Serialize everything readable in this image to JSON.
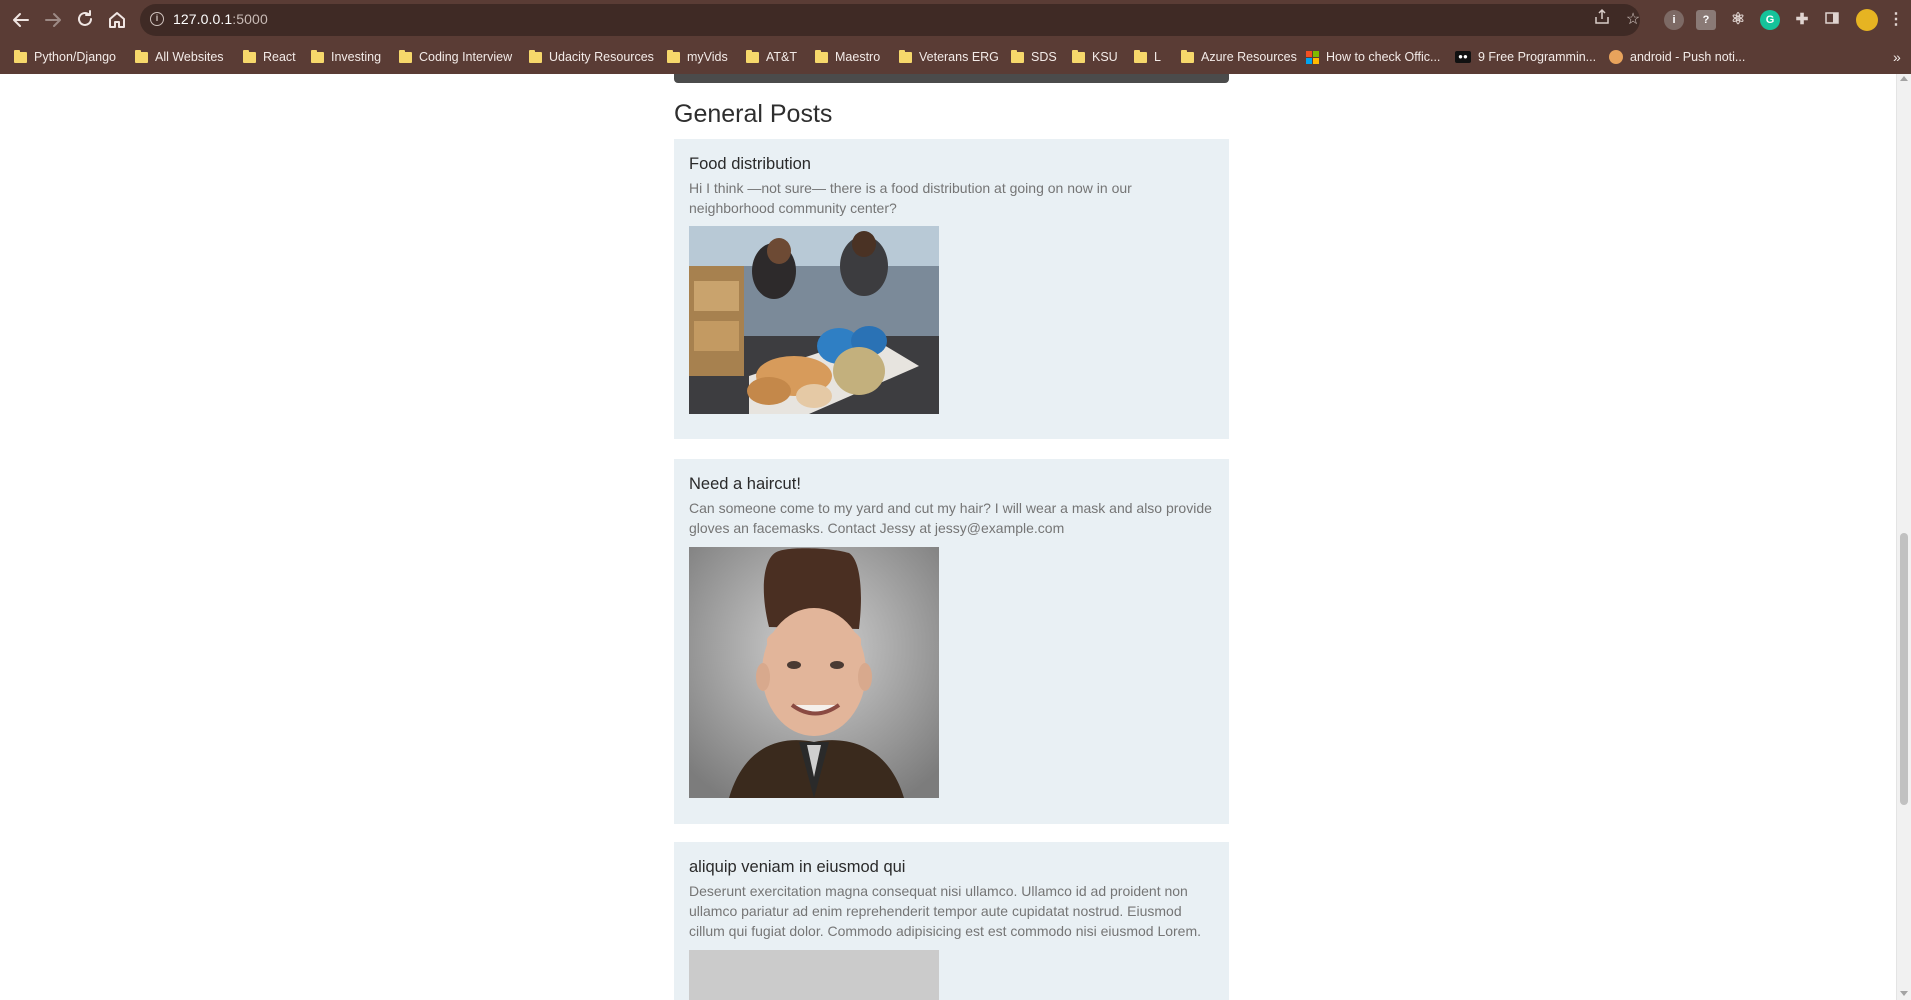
{
  "browser": {
    "url_host": "127.0.0.1",
    "url_port": ":5000",
    "bookmarks": [
      {
        "label": "Python/Django",
        "icon": "folder-icon"
      },
      {
        "label": "All Websites",
        "icon": "folder-icon"
      },
      {
        "label": "React",
        "icon": "folder-icon"
      },
      {
        "label": "Investing",
        "icon": "folder-icon"
      },
      {
        "label": "Coding Interview",
        "icon": "folder-icon"
      },
      {
        "label": "Udacity Resources",
        "icon": "folder-icon"
      },
      {
        "label": "myVids",
        "icon": "folder-icon"
      },
      {
        "label": "AT&T",
        "icon": "folder-icon"
      },
      {
        "label": "Maestro",
        "icon": "folder-icon"
      },
      {
        "label": "Veterans ERG",
        "icon": "folder-icon"
      },
      {
        "label": "SDS",
        "icon": "folder-icon"
      },
      {
        "label": "KSU",
        "icon": "folder-icon"
      },
      {
        "label": "L",
        "icon": "folder-icon"
      },
      {
        "label": "Azure Resources",
        "icon": "folder-icon"
      },
      {
        "label": "How to check Offic...",
        "icon": "microsoft-logo-icon"
      },
      {
        "label": "9 Free Programmin...",
        "icon": "medium-logo-icon"
      },
      {
        "label": "android - Push noti...",
        "icon": "android-icon"
      }
    ],
    "overflow_label": "»",
    "chrome_color": "#5a3c35",
    "bookmark_folder_color": "#f6d86b"
  },
  "page": {
    "section_title": "General Posts",
    "posts": [
      {
        "title": "Food distribution",
        "body": "Hi I think —not sure— there is a food distribution at going on now in our neighborhood community center?",
        "image": "food-distribution-photo"
      },
      {
        "title": "Need a haircut!",
        "body": "Can someone come to my yard and cut my hair? I will wear a mask and also provide gloves an facemasks. Contact Jessy at jessy@example.com",
        "image": "haircut-portrait-photo"
      },
      {
        "title": "aliquip veniam in eiusmod qui",
        "body": "Deserunt exercitation magna consequat nisi ullamco. Ullamco id ad proident non ullamco pariatur ad enim reprehenderit tempor aute cupidatat nostrud. Eiusmod cillum qui fugiat dolor. Commodo adipisicing est est commodo nisi eiusmod Lorem.",
        "image": "placeholder-image"
      }
    ],
    "post_background": "#e9f0f4"
  }
}
